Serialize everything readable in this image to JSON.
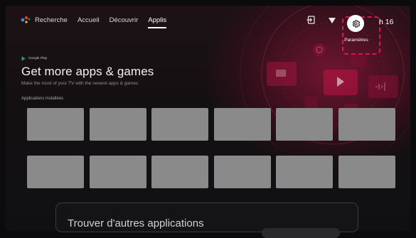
{
  "nav": {
    "search_label": "Recherche",
    "items": [
      {
        "label": "Accueil"
      },
      {
        "label": "Découvrir"
      },
      {
        "label": "Applis"
      }
    ],
    "active": "Applis"
  },
  "topbar": {
    "settings_label": "Paramètres",
    "clock": "h 16",
    "icons": [
      "input-source-icon",
      "wifi-icon",
      "gear-icon"
    ]
  },
  "store": {
    "brand": "Google Play",
    "title": "Get more apps & games",
    "subtitle": "Make the most of your TV with the newest apps & games"
  },
  "installed": {
    "label": "Applications installées",
    "rows": 2,
    "per_row": 6
  },
  "more": {
    "title": "Trouver d'autres applications"
  },
  "colors": {
    "accent": "#e0114d",
    "tile": "#8a8a8a",
    "background": "#101012"
  }
}
